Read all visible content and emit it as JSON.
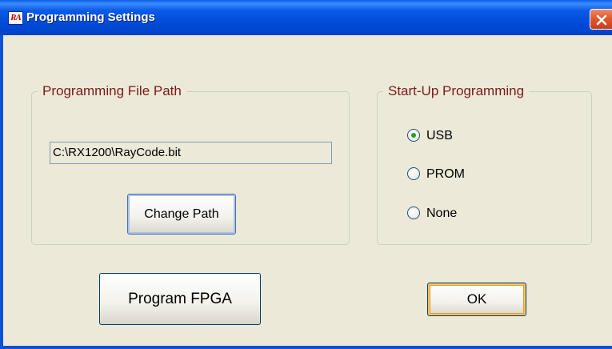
{
  "window": {
    "title": "Programming Settings",
    "icon_text": "RA",
    "close_icon": "close-x-icon"
  },
  "file_path_group": {
    "legend": "Programming File Path",
    "path_value": "C:\\RX1200\\RayCode.bit",
    "change_button": "Change Path"
  },
  "startup_group": {
    "legend": "Start-Up Programming",
    "options": [
      {
        "label": "USB",
        "selected": true
      },
      {
        "label": "PROM",
        "selected": false
      },
      {
        "label": "None",
        "selected": false
      }
    ]
  },
  "actions": {
    "program_button": "Program FPGA",
    "ok_button": "OK"
  },
  "colors": {
    "titlebar": "#0a52d8",
    "dialog_bg": "#ece9d8",
    "legend_text": "#7a1a1a",
    "close_button": "#e0582e",
    "radio_selected": "#21a121"
  }
}
